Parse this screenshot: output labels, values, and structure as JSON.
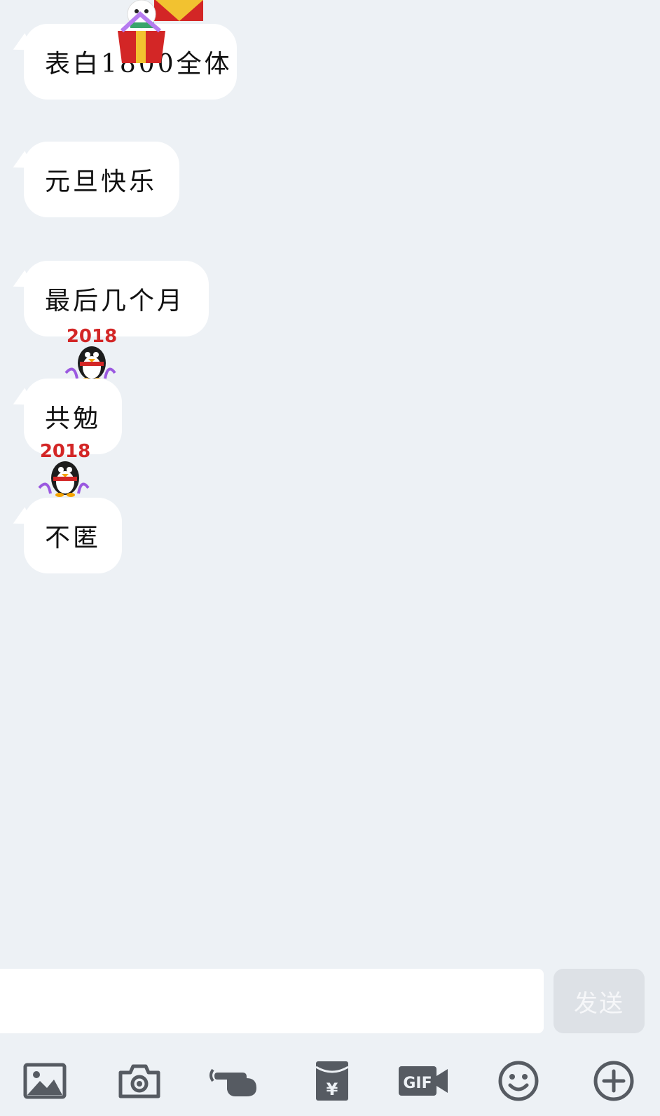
{
  "messages": [
    {
      "text": "表白1800全体"
    },
    {
      "text": "元旦快乐"
    },
    {
      "text": "最后几个月"
    },
    {
      "text": "共勉"
    },
    {
      "text": "不匿"
    }
  ],
  "stickers": {
    "penguin_year": "2018"
  },
  "input": {
    "placeholder": "",
    "value": ""
  },
  "send_label": "发送",
  "toolbar": {
    "icons": [
      "image-icon",
      "camera-icon",
      "poke-icon",
      "red-packet-icon",
      "gif-icon",
      "emoji-icon",
      "plus-icon"
    ]
  },
  "colors": {
    "background": "#edf1f5",
    "bubble": "#ffffff",
    "icon": "#565b62",
    "send_disabled_bg": "#dde1e6"
  }
}
